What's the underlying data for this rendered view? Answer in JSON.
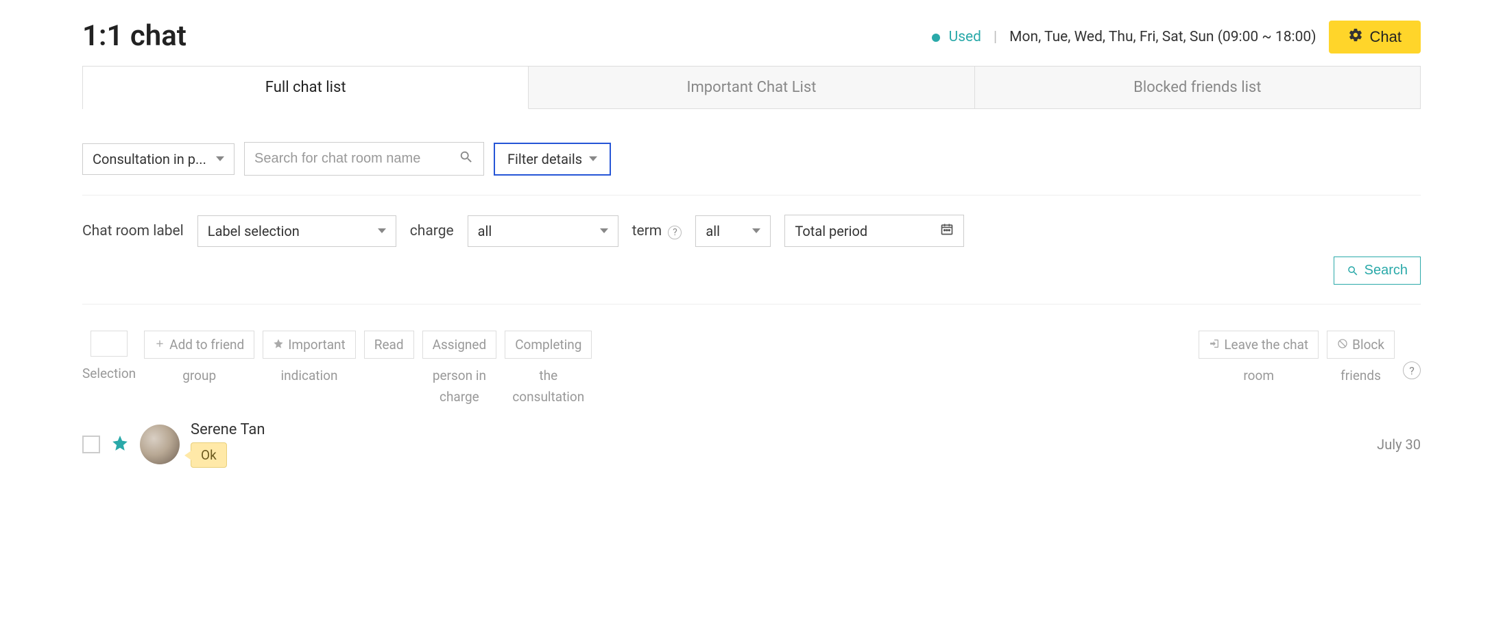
{
  "header": {
    "title": "1:1 chat",
    "status": "Used",
    "schedule": "Mon, Tue, Wed, Thu, Fri, Sat, Sun  (09:00 ~ 18:00)",
    "chat_button": "Chat"
  },
  "tabs": [
    {
      "label": "Full chat list",
      "active": true
    },
    {
      "label": "Important Chat List",
      "active": false
    },
    {
      "label": "Blocked friends list",
      "active": false
    }
  ],
  "filters1": {
    "status_select": "Consultation in p...",
    "search_placeholder": "Search for chat room name",
    "filter_details": "Filter details"
  },
  "filters2": {
    "label_chatroom": "Chat room label",
    "label_select": "Label selection",
    "label_charge": "charge",
    "charge_value": "all",
    "label_term": "term",
    "term_value": "all",
    "date_label": "Total period"
  },
  "search_button": "Search",
  "actions": {
    "selection_label": "Selection",
    "add_friend_top": "Add to friend",
    "add_friend_sub": "group",
    "important_top": "Important",
    "important_sub": "indication",
    "read": "Read",
    "assigned_top": "Assigned",
    "assigned_sub": "person in\ncharge",
    "completing_top": "Completing",
    "completing_sub": "the\nconsultation",
    "leave_top": "Leave the chat",
    "leave_sub": "room",
    "block_top": "Block",
    "block_sub": "friends"
  },
  "chat_item": {
    "name": "Serene Tan",
    "message": "Ok",
    "date": "July 30"
  }
}
